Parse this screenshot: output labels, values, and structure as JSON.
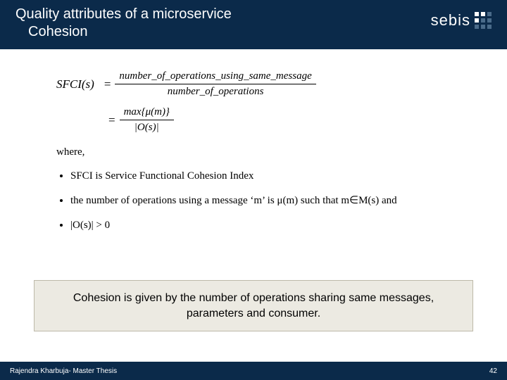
{
  "header": {
    "title_line1": "Quality attributes of a microservice",
    "title_line2": "Cohesion",
    "logo_text": "sebis"
  },
  "formula": {
    "lhs": "SFCI(s)",
    "eq": "=",
    "frac1_num": "number_of_operations_using_same_message",
    "frac1_den": "number_of_operations",
    "frac2_num": "max{μ(m)}",
    "frac2_den": "|O(s)|"
  },
  "where_label": "where,",
  "bullets": {
    "b1": "SFCI is Service Functional Cohesion Index",
    "b2": "the number of operations using a message ‘m’ is μ(m) such that m∈M(s) and",
    "b3": "|O(s)| > 0"
  },
  "note": "Cohesion is given by the number of operations sharing same messages, parameters and consumer.",
  "footer": {
    "left": "Rajendra Kharbuja- Master Thesis",
    "right": "42"
  }
}
